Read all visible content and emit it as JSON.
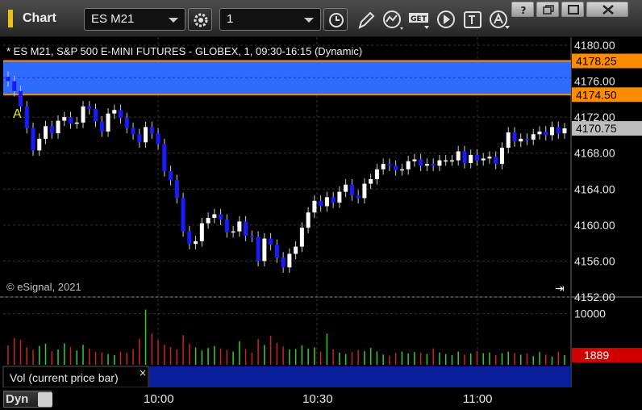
{
  "window": {
    "title": "Chart",
    "accent": "#e8c21a"
  },
  "toolbar": {
    "symbol": "ES M21",
    "interval": "1",
    "icons": [
      "settings-gear-icon",
      "clock-icon",
      "pencil-icon",
      "study-icon",
      "get-icon",
      "play-icon",
      "text-tool-icon",
      "alert-icon"
    ]
  },
  "chart": {
    "header": "* ES M21, S&P 500 E-MINI FUTURES - GLOBEX, 1, 09:30-16:15 (Dynamic)",
    "copyright": "© eSignal, 2021",
    "marker_label": "A",
    "colors": {
      "up": "#ffffff",
      "down": "#1a1aff",
      "zone": "#2f6bff",
      "zone_line": "#ff8c00",
      "grid": "#333333"
    }
  },
  "chart_data": {
    "type": "candlestick",
    "symbol": "ES M21",
    "price_axis": {
      "ticks": [
        "4180.00",
        "4176.00",
        "4172.00",
        "4168.00",
        "4164.00",
        "4160.00",
        "4156.00",
        "4152.00"
      ],
      "ylim": [
        4152,
        4180
      ]
    },
    "price_labels": [
      {
        "value": 4178.25,
        "text": "4178.25",
        "color": "#ff8c00"
      },
      {
        "value": 4174.5,
        "text": "4174.50",
        "color": "#ff8c00"
      },
      {
        "value": 4170.75,
        "text": "4170.75",
        "color": "#bdbdbd"
      }
    ],
    "zone": {
      "high": 4178.25,
      "low": 4174.5
    },
    "close_points": [
      4176.0,
      4174.9,
      4173.2,
      4170.8,
      4168.3,
      4169.6,
      4171.0,
      4170.2,
      4171.6,
      4172.0,
      4171.3,
      4171.4,
      4173.2,
      4172.9,
      4171.5,
      4170.4,
      4172.4,
      4172.8,
      4171.9,
      4170.8,
      4170.1,
      4169.2,
      4170.9,
      4170.2,
      4169.0,
      4166.0,
      4165.0,
      4163.0,
      4159.3,
      4157.9,
      4158.2,
      4160.2,
      4160.8,
      4161.2,
      4160.6,
      4159.2,
      4159.3,
      4160.4,
      4158.8,
      4158.7,
      4156.0,
      4158.5,
      4157.8,
      4156.4,
      4155.3,
      4156.8,
      4157.6,
      4159.7,
      4161.4,
      4162.7,
      4162.1,
      4163.1,
      4162.5,
      4163.7,
      4164.5,
      4163.3,
      4163.0,
      4164.6,
      4165.1,
      4166.2,
      4166.8,
      4166.6,
      4166.1,
      4166.2,
      4167.1,
      4167.3,
      4166.6,
      4166.8,
      4166.6,
      4167.2,
      4167.2,
      4167.2,
      4168.2,
      4166.9,
      4167.8,
      4167.2,
      4167.4,
      4167.6,
      4166.8,
      4168.6,
      4170.3,
      4169.3,
      4169.6,
      4169.5,
      4170.1,
      4170.4,
      4170.0,
      4170.9,
      4170.2,
      4170.75
    ],
    "time_axis": {
      "ticks": [
        "10:00",
        "10:30",
        "11:00"
      ]
    },
    "volume_axis": {
      "ticks": [
        "10000"
      ],
      "current_label": "1889"
    },
    "volume_values": [
      3800,
      5200,
      4900,
      3400,
      2900,
      3700,
      4100,
      2700,
      3000,
      4200,
      3500,
      2800,
      3900,
      3200,
      2500,
      2400,
      2100,
      1900,
      2600,
      2300,
      3100,
      5100,
      10800,
      6100,
      4800,
      3900,
      3500,
      3000,
      5800,
      4100,
      3400,
      2800,
      3300,
      3700,
      3200,
      2900,
      2600,
      4600,
      3100,
      2400,
      5100,
      3900,
      5700,
      4300,
      3600,
      3000,
      3100,
      3800,
      3200,
      3400,
      2600,
      6100,
      3000,
      2400,
      2100,
      2500,
      2900,
      2700,
      3300,
      2600,
      2000,
      1800,
      2300,
      2600,
      2200,
      2500,
      2400,
      2100,
      3200,
      2400,
      2100,
      1900,
      2600,
      2000,
      2200,
      2700,
      2300,
      2400,
      1900,
      2300,
      2600,
      2300,
      2000,
      2200,
      1700,
      2500,
      2000,
      1600,
      2600,
      1889
    ],
    "study_label": "Vol (current price bar)"
  },
  "status": {
    "mode": "Dyn"
  }
}
